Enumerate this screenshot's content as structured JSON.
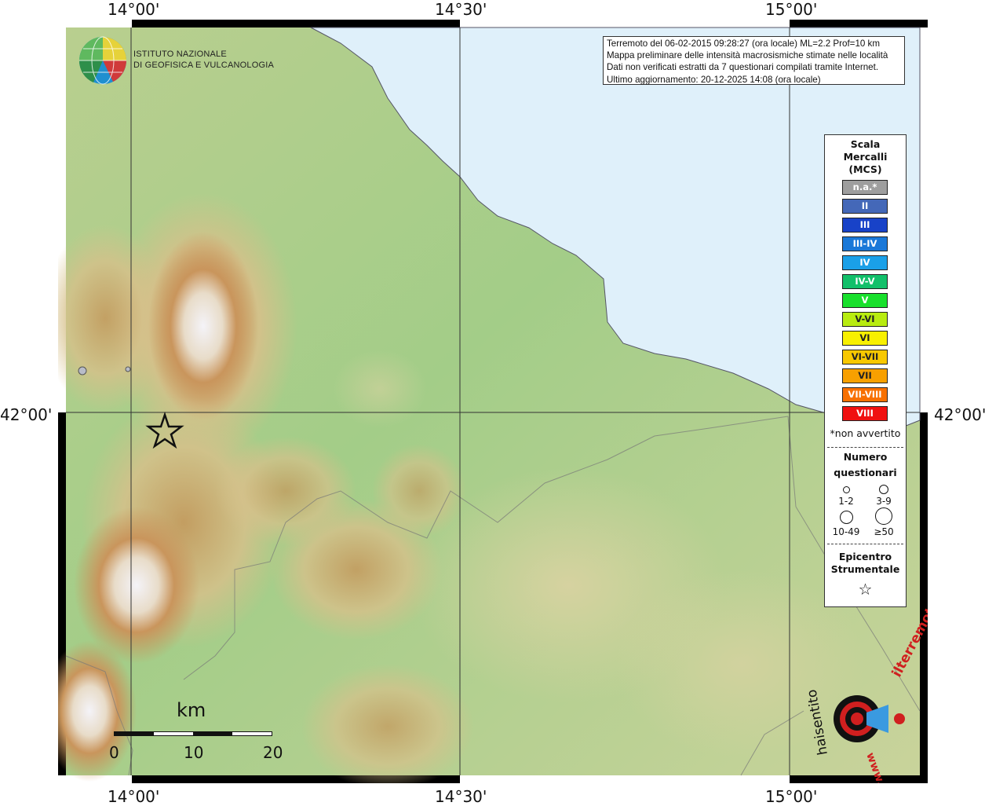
{
  "coords": {
    "lon_top": [
      "14°00'",
      "14°30'",
      "15°00'"
    ],
    "lon_bottom": [
      "14°00'",
      "14°30'",
      "15°00'"
    ],
    "lat_left": "42°00'",
    "lat_right": "42°00'"
  },
  "logo": {
    "line1": "ISTITUTO NAZIONALE",
    "line2": "DI GEOFISICA E VULCANOLOGIA"
  },
  "info": {
    "line1": "Terremoto del 06-02-2015 09:28:27 (ora locale) ML=2.2 Prof=10 km",
    "line2": "Mappa preliminare delle intensità macrosismiche stimate nelle località",
    "line3": "Dati non verificati estratti da 7 questionari compilati tramite Internet.",
    "line4": "Ultimo aggiornamento: 20-12-2025 14:08 (ora locale)"
  },
  "legend": {
    "title1": "Scala",
    "title2": "Mercalli",
    "title3": "(MCS)",
    "intensity": [
      {
        "label": "n.a.*",
        "color": "#9e9e9e"
      },
      {
        "label": "II",
        "color": "#4468b8"
      },
      {
        "label": "III",
        "color": "#1842c8"
      },
      {
        "label": "III-IV",
        "color": "#1a78d8"
      },
      {
        "label": "IV",
        "color": "#1aa0e8"
      },
      {
        "label": "IV-V",
        "color": "#12c06a"
      },
      {
        "label": "V",
        "color": "#18e02c"
      },
      {
        "label": "V-VI",
        "color": "#b8ec10"
      },
      {
        "label": "VI",
        "color": "#f8f000"
      },
      {
        "label": "VI-VII",
        "color": "#f8c800"
      },
      {
        "label": "VII",
        "color": "#f8a000"
      },
      {
        "label": "VII-VIII",
        "color": "#f87000"
      },
      {
        "label": "VIII",
        "color": "#f01010"
      }
    ],
    "note": "*non avvertito",
    "q_title1": "Numero",
    "q_title2": "questionari",
    "q_sizes": [
      "1-2",
      "3-9",
      "10-49",
      "≥50"
    ],
    "epi_title1": "Epicentro",
    "epi_title2": "Strumentale",
    "epi_symbol": "☆"
  },
  "scalebar": {
    "unit": "km",
    "labels": [
      "0",
      "10",
      "20"
    ]
  },
  "brand": {
    "text1": "haisentito",
    "text2": "ilterremoto.it",
    "text3": "www."
  },
  "colors": {
    "sea": "#dff0fa",
    "lowland": "#a7cf8b",
    "hill": "#d2cf99",
    "mountain": "#c8955a",
    "peak": "#f3f2f7"
  }
}
